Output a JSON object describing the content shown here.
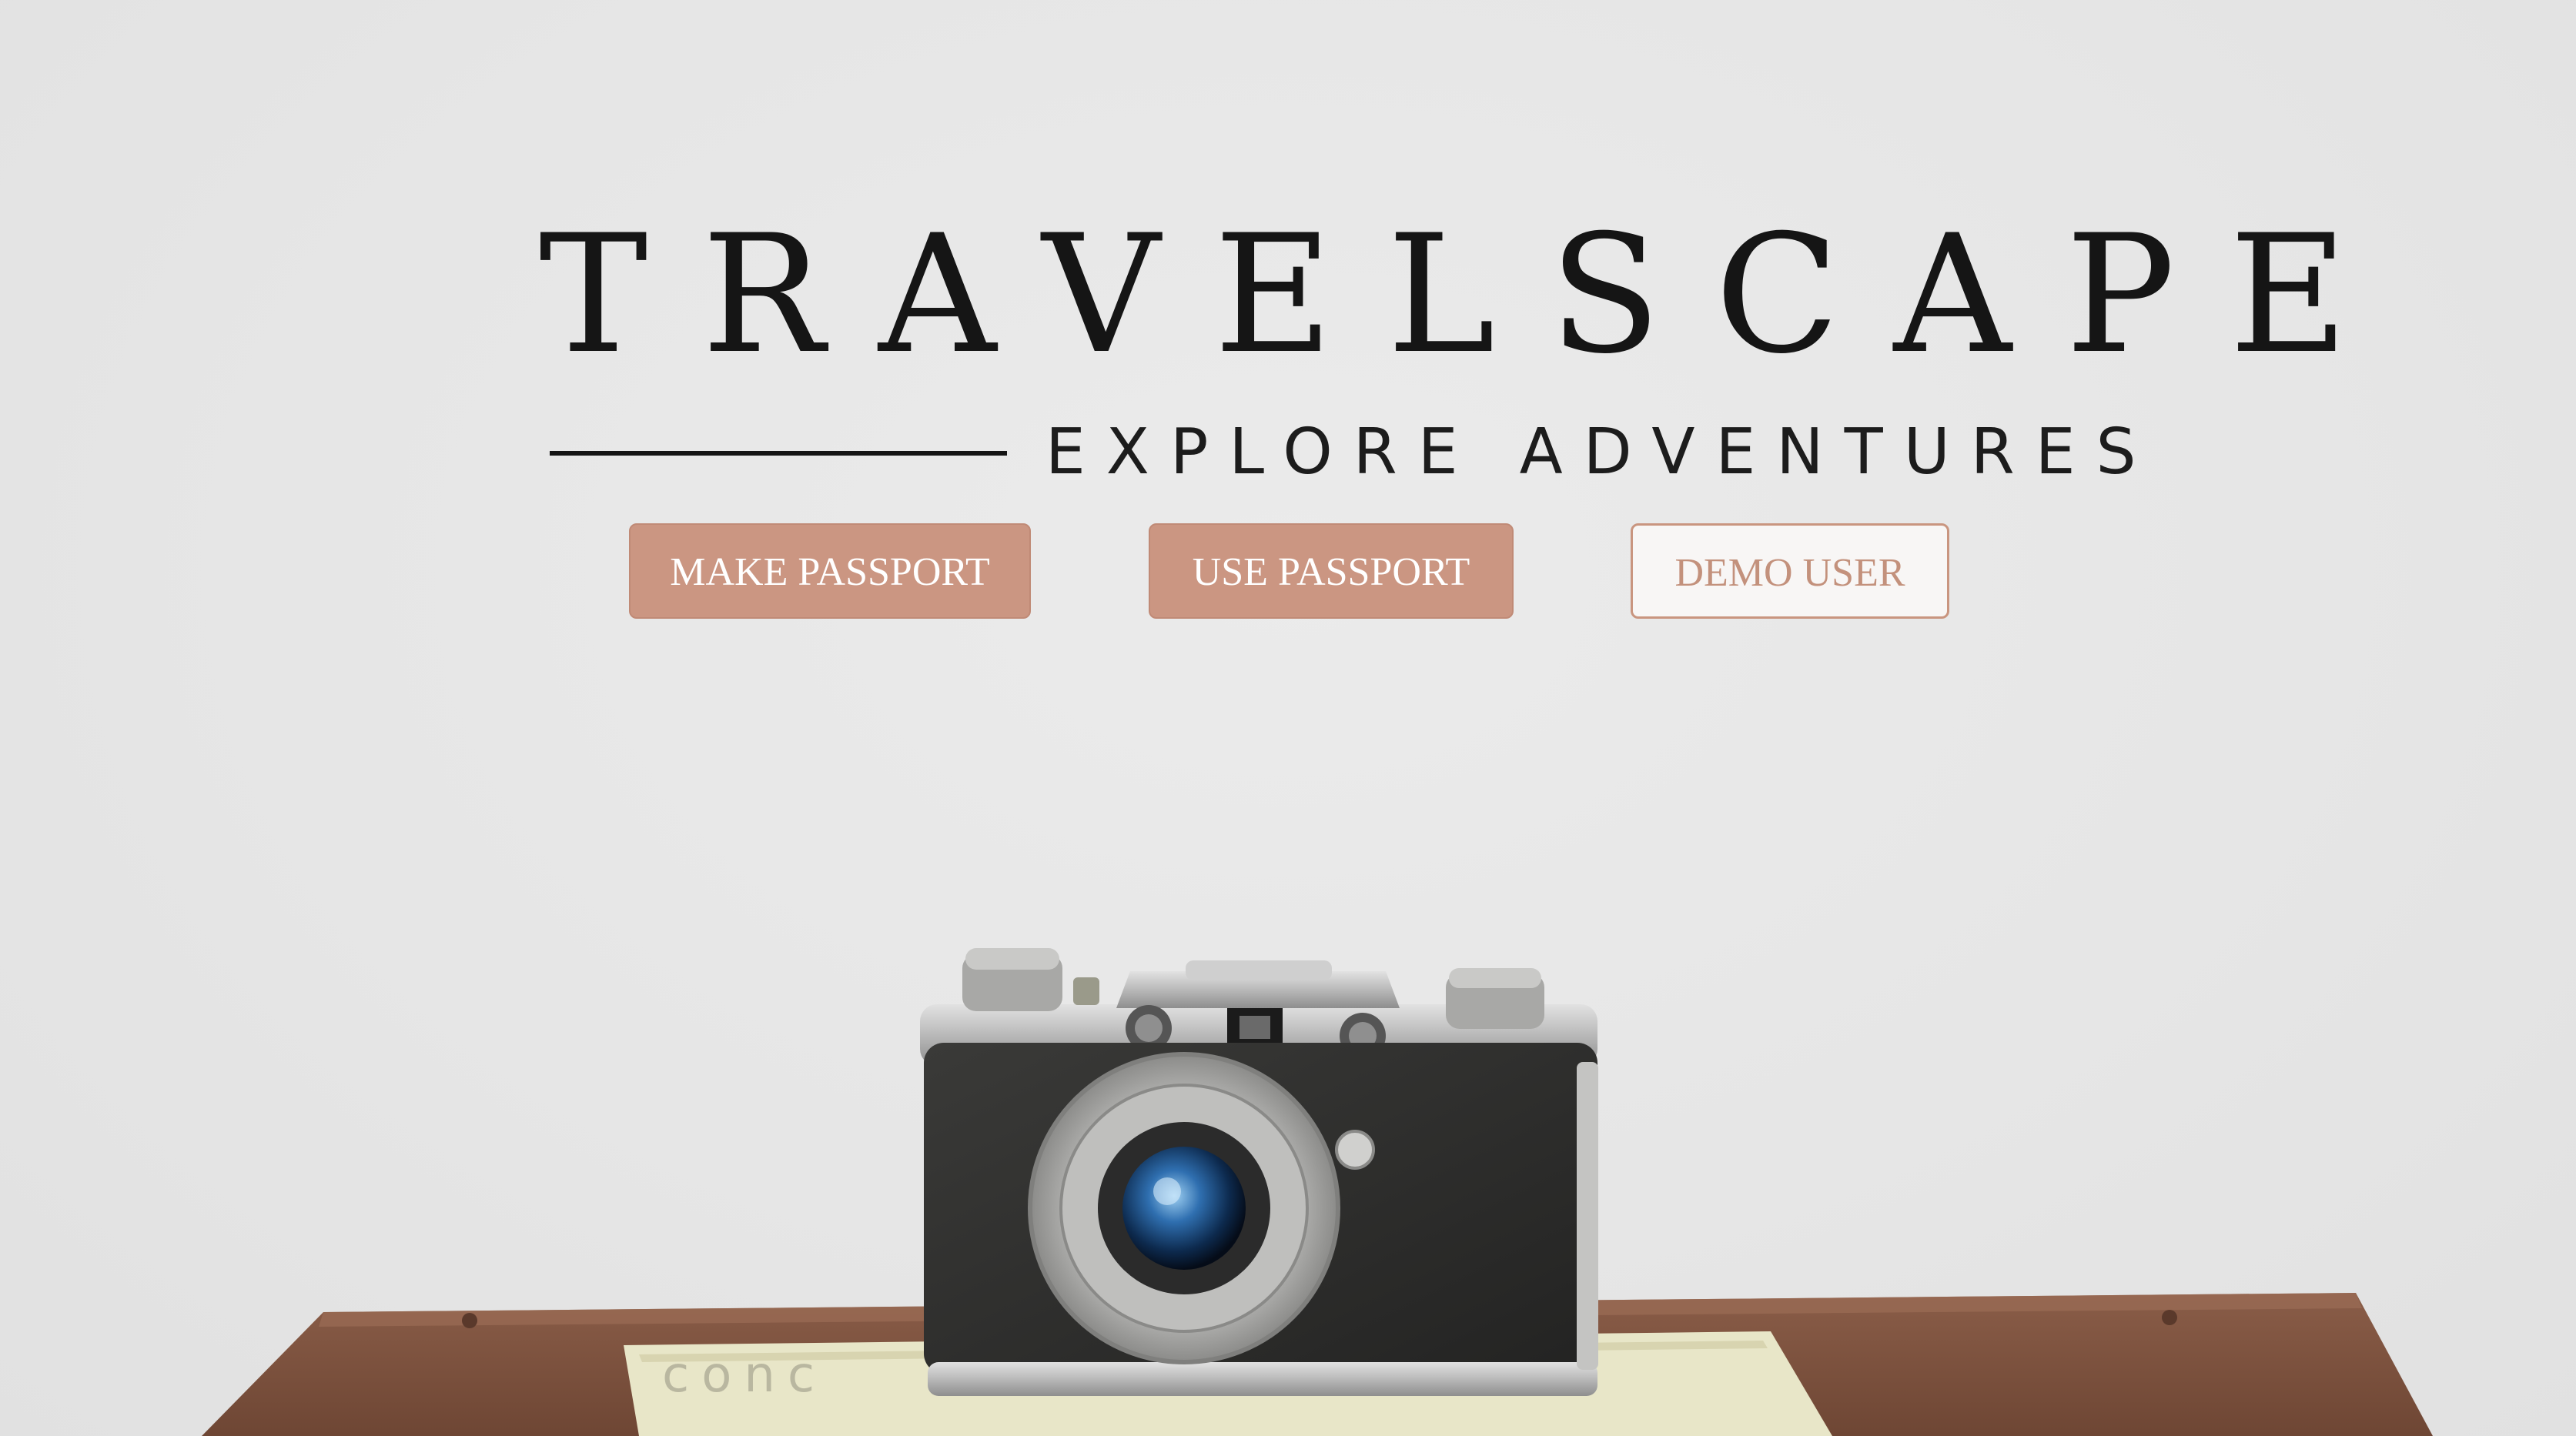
{
  "brand": {
    "title": "TRAVELSCAPE",
    "tagline": "EXPLORE ADVENTURES"
  },
  "actions": {
    "make_passport_label": "MAKE PASSPORT",
    "use_passport_label": "USE PASSPORT",
    "demo_user_label": "DEMO USER"
  },
  "hero_image": {
    "icon": "vintage-camera-photo"
  },
  "colors": {
    "accent": "#cb9682",
    "background": "#e6e6e6",
    "text": "#151515"
  }
}
